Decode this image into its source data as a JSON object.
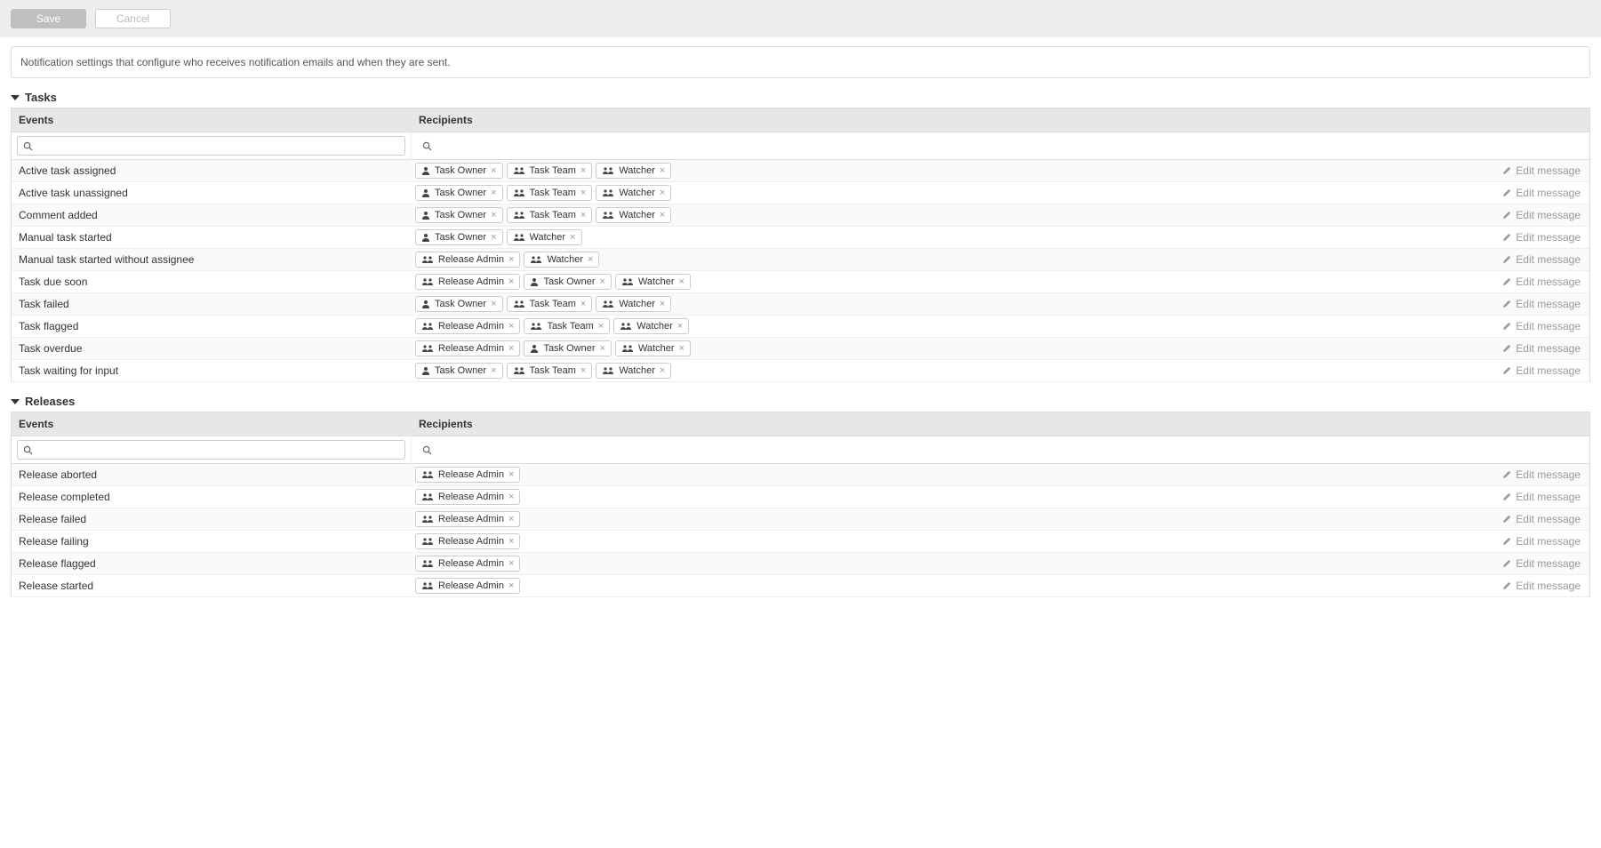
{
  "toolbar": {
    "save_label": "Save",
    "cancel_label": "Cancel"
  },
  "description": "Notification settings that configure who receives notification emails and when they are sent.",
  "edit_message_label": "Edit message",
  "columns": {
    "events": "Events",
    "recipients": "Recipients"
  },
  "sections": [
    {
      "title": "Tasks",
      "rows": [
        {
          "event": "Active task assigned",
          "recipients": [
            {
              "type": "person",
              "name": "Task Owner"
            },
            {
              "type": "group",
              "name": "Task Team"
            },
            {
              "type": "group",
              "name": "Watcher"
            }
          ]
        },
        {
          "event": "Active task unassigned",
          "recipients": [
            {
              "type": "person",
              "name": "Task Owner"
            },
            {
              "type": "group",
              "name": "Task Team"
            },
            {
              "type": "group",
              "name": "Watcher"
            }
          ]
        },
        {
          "event": "Comment added",
          "recipients": [
            {
              "type": "person",
              "name": "Task Owner"
            },
            {
              "type": "group",
              "name": "Task Team"
            },
            {
              "type": "group",
              "name": "Watcher"
            }
          ]
        },
        {
          "event": "Manual task started",
          "recipients": [
            {
              "type": "person",
              "name": "Task Owner"
            },
            {
              "type": "group",
              "name": "Watcher"
            }
          ]
        },
        {
          "event": "Manual task started without assignee",
          "recipients": [
            {
              "type": "group",
              "name": "Release Admin"
            },
            {
              "type": "group",
              "name": "Watcher"
            }
          ]
        },
        {
          "event": "Task due soon",
          "recipients": [
            {
              "type": "group",
              "name": "Release Admin"
            },
            {
              "type": "person",
              "name": "Task Owner"
            },
            {
              "type": "group",
              "name": "Watcher"
            }
          ]
        },
        {
          "event": "Task failed",
          "recipients": [
            {
              "type": "person",
              "name": "Task Owner"
            },
            {
              "type": "group",
              "name": "Task Team"
            },
            {
              "type": "group",
              "name": "Watcher"
            }
          ]
        },
        {
          "event": "Task flagged",
          "recipients": [
            {
              "type": "group",
              "name": "Release Admin"
            },
            {
              "type": "group",
              "name": "Task Team"
            },
            {
              "type": "group",
              "name": "Watcher"
            }
          ]
        },
        {
          "event": "Task overdue",
          "recipients": [
            {
              "type": "group",
              "name": "Release Admin"
            },
            {
              "type": "person",
              "name": "Task Owner"
            },
            {
              "type": "group",
              "name": "Watcher"
            }
          ]
        },
        {
          "event": "Task waiting for input",
          "recipients": [
            {
              "type": "person",
              "name": "Task Owner"
            },
            {
              "type": "group",
              "name": "Task Team"
            },
            {
              "type": "group",
              "name": "Watcher"
            }
          ]
        }
      ]
    },
    {
      "title": "Releases",
      "rows": [
        {
          "event": "Release aborted",
          "recipients": [
            {
              "type": "group",
              "name": "Release Admin"
            }
          ]
        },
        {
          "event": "Release completed",
          "recipients": [
            {
              "type": "group",
              "name": "Release Admin"
            }
          ]
        },
        {
          "event": "Release failed",
          "recipients": [
            {
              "type": "group",
              "name": "Release Admin"
            }
          ]
        },
        {
          "event": "Release failing",
          "recipients": [
            {
              "type": "group",
              "name": "Release Admin"
            }
          ]
        },
        {
          "event": "Release flagged",
          "recipients": [
            {
              "type": "group",
              "name": "Release Admin"
            }
          ]
        },
        {
          "event": "Release started",
          "recipients": [
            {
              "type": "group",
              "name": "Release Admin"
            }
          ]
        }
      ]
    }
  ]
}
